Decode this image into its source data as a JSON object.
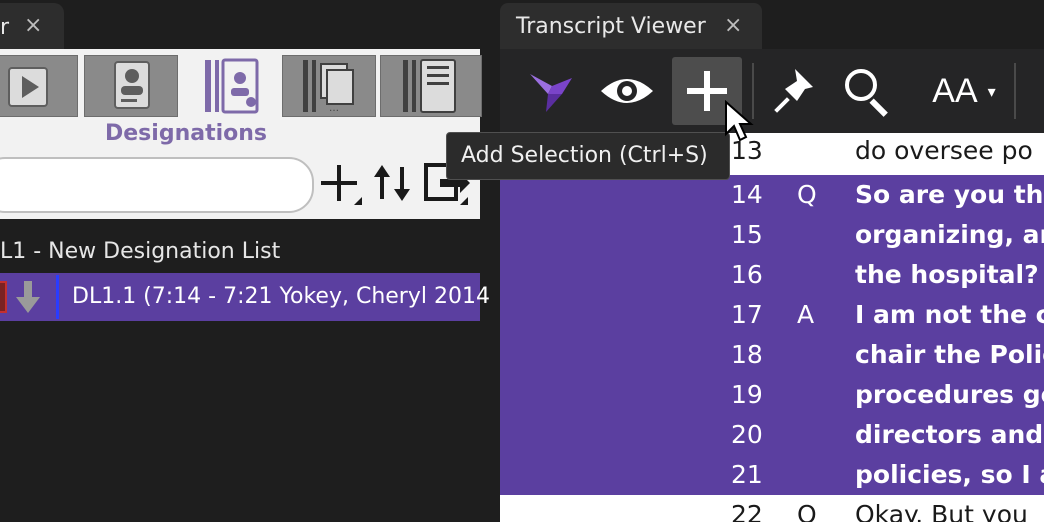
{
  "left_panel": {
    "tab_title": "r",
    "close_glyph": "×",
    "toolbar_tabs": [
      {
        "icon": "play-icon"
      },
      {
        "icon": "person-icon"
      },
      {
        "icon": "designation-icon",
        "selected": true
      },
      {
        "icon": "stacked-pages-icon"
      },
      {
        "icon": "notebook-icon"
      }
    ],
    "active_section": "Designations",
    "search": {
      "value": "",
      "placeholder": ""
    },
    "action_icons": [
      "add-icon",
      "sort-icon",
      "export-icon"
    ],
    "list_header": "L1 - New Designation List",
    "list_item": "DL1.1 (7:14 - 7:21 Yokey, Cheryl 2014"
  },
  "right_panel": {
    "tab_title": "Transcript Viewer",
    "close_glyph": "×",
    "toolbar": {
      "buttons": [
        "logo-bird-icon",
        "eye-icon",
        "add-icon",
        "pin-icon",
        "search-icon",
        "font-size-icon"
      ],
      "font_size_label": "AA",
      "font_size_arrow": "▾"
    },
    "tooltip": "Add Selection (Ctrl+S)",
    "lines": [
      {
        "num": "13",
        "speaker": "",
        "text": "do oversee po",
        "highlight": false
      },
      {
        "num": "14",
        "speaker": "Q",
        "text": "So are you th",
        "highlight": true
      },
      {
        "num": "15",
        "speaker": "",
        "text": "organizing, ar",
        "highlight": true
      },
      {
        "num": "16",
        "speaker": "",
        "text": "the hospital?",
        "highlight": true
      },
      {
        "num": "17",
        "speaker": "A",
        "text": "I am not the c",
        "highlight": true
      },
      {
        "num": "18",
        "speaker": "",
        "text": "chair the Polic",
        "highlight": true
      },
      {
        "num": "19",
        "speaker": "",
        "text": "procedures go",
        "highlight": true
      },
      {
        "num": "20",
        "speaker": "",
        "text": "directors and",
        "highlight": true
      },
      {
        "num": "21",
        "speaker": "",
        "text": "policies, so I a",
        "highlight": true
      },
      {
        "num": "22",
        "speaker": "Q",
        "text": "Okay. But you",
        "highlight": false
      }
    ]
  },
  "colors": {
    "highlight": "#5b3fa0",
    "accent": "#7e6aa9",
    "panel_bg": "#1e1e1e"
  }
}
